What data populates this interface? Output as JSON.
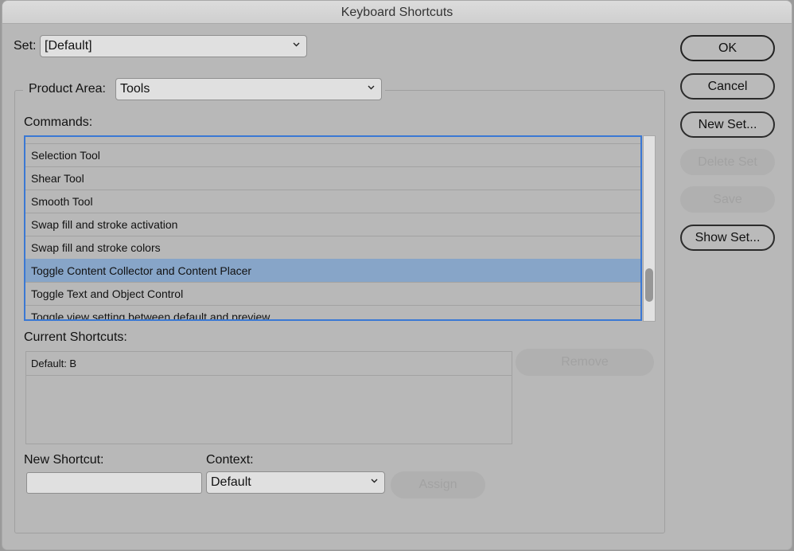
{
  "window": {
    "title": "Keyboard Shortcuts"
  },
  "set": {
    "label": "Set:",
    "value": "[Default]"
  },
  "product_area": {
    "label": "Product Area:",
    "value": "Tools"
  },
  "commands": {
    "label": "Commands:",
    "items": [
      {
        "label": "Selection Tool",
        "selected": false
      },
      {
        "label": "Shear Tool",
        "selected": false
      },
      {
        "label": "Smooth Tool",
        "selected": false
      },
      {
        "label": "Swap fill and stroke activation",
        "selected": false
      },
      {
        "label": "Swap fill and stroke colors",
        "selected": false
      },
      {
        "label": "Toggle Content Collector and Content Placer",
        "selected": true
      },
      {
        "label": "Toggle Text and Object Control",
        "selected": false
      },
      {
        "label": "Toggle view setting between default and preview",
        "selected": false
      }
    ],
    "selected_color": "#87a5c8",
    "focus_color": "#3a78d4"
  },
  "current_shortcuts": {
    "label": "Current Shortcuts:",
    "items": [
      "Default: B"
    ],
    "remove_label": "Remove"
  },
  "new_shortcut": {
    "label": "New Shortcut:",
    "value": ""
  },
  "context": {
    "label": "Context:",
    "value": "Default"
  },
  "assign": {
    "label": "Assign"
  },
  "buttons": {
    "ok": "OK",
    "cancel": "Cancel",
    "new_set": "New Set...",
    "delete_set": "Delete Set",
    "save": "Save",
    "show_set": "Show Set..."
  }
}
